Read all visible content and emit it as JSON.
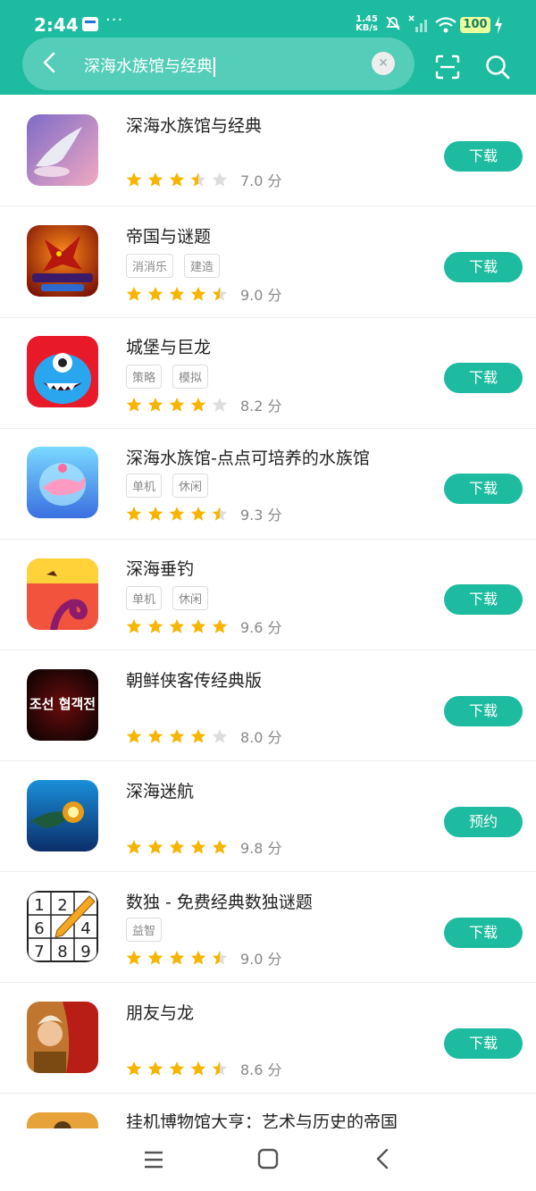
{
  "status": {
    "time": "2:44",
    "speed_value": "1.45",
    "speed_unit": "KB/s",
    "battery": "100"
  },
  "search": {
    "query": "深海水族馆与经典"
  },
  "apps": [
    {
      "name": "深海水族馆与经典",
      "tags": [],
      "rating": 3.5,
      "score": "7.0 分",
      "button": "下载"
    },
    {
      "name": "帝国与谜题",
      "tags": [
        "消消乐",
        "建造"
      ],
      "rating": 4.5,
      "score": "9.0 分",
      "button": "下载"
    },
    {
      "name": "城堡与巨龙",
      "tags": [
        "策略",
        "模拟"
      ],
      "rating": 4,
      "score": "8.2 分",
      "button": "下载"
    },
    {
      "name": "深海水族馆-点点可培养的水族馆",
      "tags": [
        "单机",
        "休闲"
      ],
      "rating": 4.5,
      "score": "9.3 分",
      "button": "下载"
    },
    {
      "name": "深海垂钓",
      "tags": [
        "单机",
        "休闲"
      ],
      "rating": 5,
      "score": "9.6 分",
      "button": "下载"
    },
    {
      "name": "朝鲜侠客传经典版",
      "tags": [],
      "rating": 4,
      "score": "8.0 分",
      "button": "下载"
    },
    {
      "name": "深海迷航",
      "tags": [],
      "rating": 5,
      "score": "9.8 分",
      "button": "预约"
    },
    {
      "name": "数独 - 免费经典数独谜题",
      "tags": [
        "益智"
      ],
      "rating": 4.5,
      "score": "9.0 分",
      "button": "下载"
    },
    {
      "name": "朋友与龙",
      "tags": [],
      "rating": 4.5,
      "score": "8.6 分",
      "button": "下载"
    },
    {
      "name": "挂机博物馆大亨：艺术与历史的帝国",
      "tags": [],
      "rating": 0,
      "score": "",
      "button": ""
    }
  ],
  "icons": {
    "1": "whale-icon",
    "2": "dragon-empires-icon",
    "3": "monster-icon",
    "4": "pink-whale-icon",
    "5": "octopus-fishing-icon",
    "6": "korean-title-icon",
    "7": "deep-sea-fish-icon",
    "8": "sudoku-grid-icon",
    "9": "heroes-dragon-icon",
    "10": "museum-icon"
  },
  "sudoku_icon_digits": [
    "1",
    "2",
    "",
    "6",
    "",
    "4",
    "7",
    "8",
    "9"
  ],
  "korean_icon_text": "조선 협객전",
  "colors": {
    "accent": "#1dbb9f",
    "star": "#f7b500"
  }
}
